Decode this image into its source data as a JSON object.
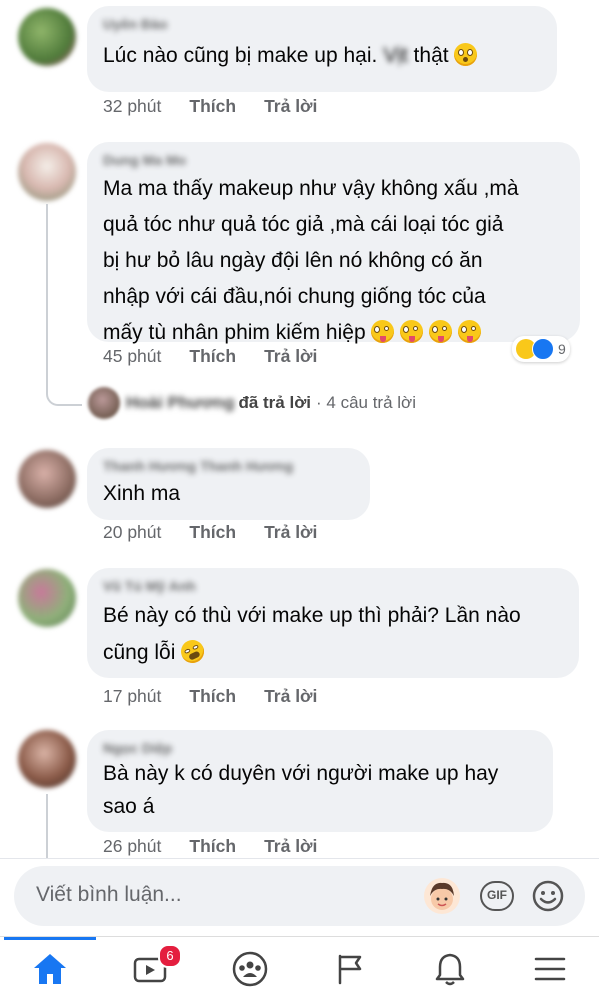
{
  "comments": [
    {
      "author": "Uyên Đào",
      "text": "Lúc nào cũng bị make up hại. Vịt thật",
      "time": "32 phút",
      "like": "Thích",
      "reply": "Trả lời"
    },
    {
      "author": "Dung Ma Mo",
      "text": "Ma ma thấy makeup như vậy không xấu ,mà\nquả tóc như quả tóc giả ,mà cái loại tóc giả\nbị hư bỏ lâu ngày đội lên nó không có ăn\nnhập với  cái đầu,nói chung giống tóc của\nmấy tù nhân phim kiếm hiệp",
      "time": "45 phút",
      "like": "Thích",
      "reply": "Trả lời",
      "reaction_count": "9"
    },
    {
      "author": "Thanh Hương Thanh Hương",
      "text": "Xinh ma",
      "time": "20 phút",
      "like": "Thích",
      "reply": "Trả lời"
    },
    {
      "author": "Vũ Tú Mỹ Anh",
      "text": "Bé này có thù với make up thì phải? Lần nào\ncũng lỗi",
      "time": "17 phút",
      "like": "Thích",
      "reply": "Trả lời"
    },
    {
      "author": "Ngọc Diệp",
      "text": "Bà này k có duyên với người make up hay\nsao á",
      "time": "26 phút",
      "like": "Thích",
      "reply": "Trả lời"
    }
  ],
  "reply_summary": {
    "name": "Hoài Phương",
    "action": "đã trả lời",
    "count": "· 4 câu trả lời"
  },
  "composer": {
    "placeholder": "Viết bình luận...",
    "gif_label": "GIF"
  },
  "tabbar": {
    "video_badge": "6"
  },
  "colors": {
    "accent": "#1877f2",
    "bubble": "#eff1f4",
    "meta": "#65676b",
    "badge": "#e41e3f"
  }
}
